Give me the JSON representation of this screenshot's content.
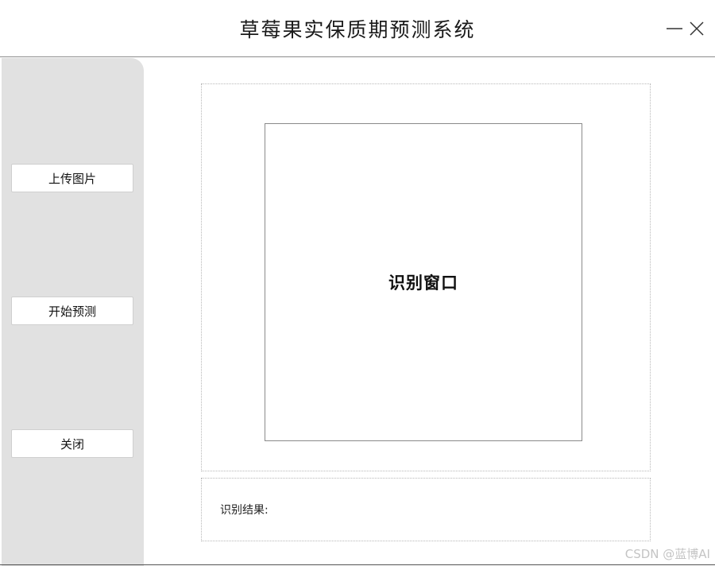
{
  "window": {
    "title": "草莓果实保质期预测系统"
  },
  "sidebar": {
    "upload_label": "上传图片",
    "start_label": "开始预测",
    "close_label": "关闭"
  },
  "main": {
    "recognition_window_label": "识别窗口",
    "result_label": "识别结果:"
  },
  "watermark": "CSDN @蓝博AI",
  "colors": {
    "sidebar_bg": "#e1e1e1",
    "window_bg": "#ffffff"
  },
  "icons": {
    "minimize": "minimize-icon",
    "close": "close-icon"
  }
}
